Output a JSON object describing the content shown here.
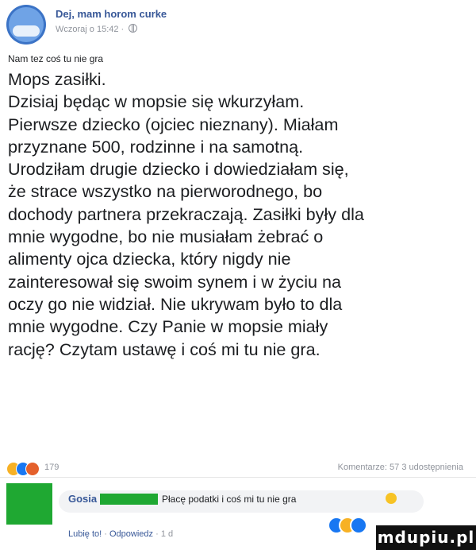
{
  "header": {
    "page_name": "Dej, mam horom curke",
    "timestamp": "Wczoraj o 15:42 ·",
    "privacy_icon": "globe-icon"
  },
  "post": {
    "intro": "Nam tez coś tu nie gra",
    "lines": [
      "Mops zasiłki.",
      "Dzisiaj będąc w mopsie się wkurzyłam.",
      "Pierwsze dziecko (ojciec nieznany). Miałam",
      "przyznane 500, rodzinne i na samotną.",
      "Urodziłam drugie dziecko i dowiedziałam się,",
      "że strace wszystko na pierworodnego, bo",
      "dochody partnera przekraczają. Zasiłki były dla",
      "mnie wygodne, bo nie musiałam żebrać o",
      "alimenty ojca dziecka, który nigdy nie",
      "zainteresował się swoim synem i w życiu na",
      "oczy go nie widział. Nie ukrywam było to dla",
      "mnie wygodne. Czy Panie w mopsie miały",
      "rację? Czytam ustawę i coś mi tu nie gra."
    ]
  },
  "stats": {
    "reaction_count": "179",
    "comments_shares": "Komentarze: 57   3 udostępnienia",
    "reaction_icons": [
      "haha-icon",
      "like-icon",
      "angry-icon"
    ]
  },
  "comment": {
    "author": "Gosia",
    "text": "Płacę podatki i coś mi tu nie gra",
    "like_label": "Lubię to!",
    "reply_label": "Odpowiedz",
    "time": "1 d",
    "colors": {
      "redaction": "#1fa832"
    }
  },
  "watermark": {
    "text": "mdupiu.pl"
  }
}
